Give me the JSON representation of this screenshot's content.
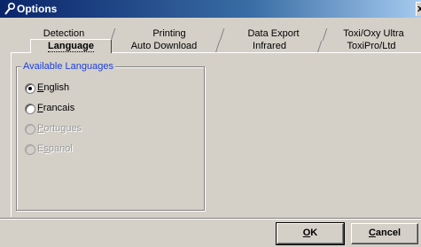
{
  "window": {
    "title": "Options",
    "close_glyph": "x"
  },
  "tabs_back_row": [
    {
      "label": "Detection"
    },
    {
      "label": "Printing"
    },
    {
      "label": "Data Export"
    },
    {
      "label": "Toxi/Oxy Ultra"
    }
  ],
  "tabs_front_row": [
    {
      "label": "Language",
      "active": true
    },
    {
      "label": "Auto Download",
      "active": false
    },
    {
      "label": "Infrared",
      "active": false
    },
    {
      "label": "ToxiPro/Ltd",
      "active": false
    }
  ],
  "group": {
    "title": "Available Languages",
    "options": [
      {
        "mnemonic": "E",
        "rest": "nglish",
        "selected": true,
        "enabled": true
      },
      {
        "mnemonic": "F",
        "rest": "rancais",
        "selected": false,
        "enabled": true
      },
      {
        "mnemonic": "P",
        "rest": "ortugues",
        "selected": false,
        "enabled": false
      },
      {
        "prefix": "E",
        "mnemonic": "s",
        "rest": "panol",
        "selected": false,
        "enabled": false
      }
    ]
  },
  "buttons": {
    "ok": {
      "mnemonic": "O",
      "rest": "K"
    },
    "cancel": {
      "mnemonic": "C",
      "rest": "ancel"
    }
  },
  "colors": {
    "title_bar": "#0a246a",
    "group_title": "#1c3fd6",
    "dialog_face": "#d4d0c8"
  },
  "icons": {
    "title": "wrench-icon"
  }
}
